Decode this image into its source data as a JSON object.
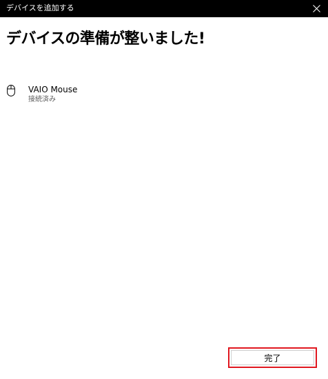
{
  "window": {
    "title": "デバイスを追加する",
    "close_icon": "close-icon"
  },
  "page": {
    "heading": "デバイスの準備が整いました!"
  },
  "devices": [
    {
      "name": "VAIO Mouse",
      "status": "接続済み",
      "icon": "mouse-icon"
    }
  ],
  "actions": {
    "done_label": "完了"
  },
  "colors": {
    "titlebar_bg": "#000000",
    "highlight_border": "#e0161e",
    "status_text": "#5d5d5d"
  }
}
